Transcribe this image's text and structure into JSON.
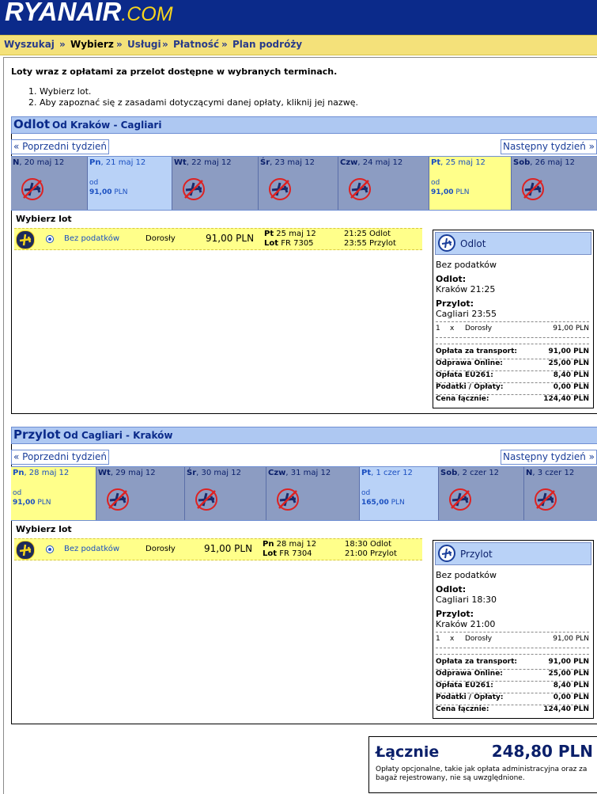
{
  "logo": {
    "brand": "RYANAIR",
    "suffix": ".COM"
  },
  "breadcrumb": [
    "Wyszukaj",
    "»",
    "Wybierz",
    "»",
    "Usługi",
    "»",
    "Płatność",
    "»",
    "Plan podróży"
  ],
  "intro": {
    "title": "Loty wraz z opłatami za przelot dostępne w wybranych terminach.",
    "items": [
      "1.  Wybierz lot.",
      "2.  Aby zapoznać się z zasadami dotyczącymi danej opłaty, kliknij jej nazwę."
    ]
  },
  "prev_week": "« Poprzedni tydzień",
  "next_week": "Następny tydzień »",
  "choose_flight": "Wybierz lot",
  "outbound": {
    "heading": "Odlot",
    "route": "Od Kraków - Cagliari",
    "days": [
      {
        "dow": "N",
        "date": ", 20 maj 12",
        "status": "none"
      },
      {
        "dow": "Pn",
        "date": ", 21 maj 12",
        "status": "available",
        "od": "od",
        "price": "91,00",
        "cur": "PLN"
      },
      {
        "dow": "Wt",
        "date": ", 22 maj 12",
        "status": "none"
      },
      {
        "dow": "Śr",
        "date": ", 23 maj 12",
        "status": "none"
      },
      {
        "dow": "Czw",
        "date": ", 24 maj 12",
        "status": "none"
      },
      {
        "dow": "Pt",
        "date": ", 25 maj 12",
        "status": "selected",
        "od": "od",
        "price": "91,00",
        "cur": "PLN"
      },
      {
        "dow": "Sob",
        "date": ", 26 maj 12",
        "status": "none"
      }
    ],
    "flight": {
      "fare": "Bez podatków",
      "pax": "Dorosły",
      "price": "91,00 PLN",
      "dow": "Pt",
      "date": "25 maj 12",
      "lot_label": "Lot",
      "flight_no": "FR 7305",
      "dep": "21:25 Odlot",
      "arr": "23:55 Przylot"
    },
    "summary": {
      "title": "Odlot",
      "fare": "Bez podatków",
      "dep_label": "Odlot:",
      "dep_value": "Kraków 21:25",
      "arr_label": "Przylot:",
      "arr_value": "Cagliari 23:55",
      "line": {
        "qty": "1",
        "x": "x",
        "pax": "Dorosły",
        "amount": "91,00 PLN"
      },
      "rows": [
        {
          "label": "Opłata za transport:",
          "value": "91,00 PLN"
        },
        {
          "label": "Odprawa Online:",
          "value": "25,00 PLN"
        },
        {
          "label": "Opłata EU261:",
          "value": "8,40 PLN"
        },
        {
          "label": "Podatki / Opłaty:",
          "value": "0,00 PLN"
        },
        {
          "label": "Cena łącznie:",
          "value": "124,40 PLN"
        }
      ]
    }
  },
  "inbound": {
    "heading": "Przylot",
    "route": "Od Cagliari - Kraków",
    "days": [
      {
        "dow": "Pn",
        "date": ", 28 maj 12",
        "status": "selected",
        "od": "od",
        "price": "91,00",
        "cur": "PLN"
      },
      {
        "dow": "Wt",
        "date": ", 29 maj 12",
        "status": "none"
      },
      {
        "dow": "Śr",
        "date": ", 30 maj 12",
        "status": "none"
      },
      {
        "dow": "Czw",
        "date": ", 31 maj 12",
        "status": "none"
      },
      {
        "dow": "Pt",
        "date": ", 1 czer 12",
        "status": "available",
        "od": "od",
        "price": "165,00",
        "cur": "PLN"
      },
      {
        "dow": "Sob",
        "date": ", 2 czer 12",
        "status": "none"
      },
      {
        "dow": "N",
        "date": ", 3 czer 12",
        "status": "none"
      }
    ],
    "flight": {
      "fare": "Bez podatków",
      "pax": "Dorosły",
      "price": "91,00 PLN",
      "dow": "Pn",
      "date": "28 maj 12",
      "lot_label": "Lot",
      "flight_no": "FR 7304",
      "dep": "18:30 Odlot",
      "arr": "21:00 Przylot"
    },
    "summary": {
      "title": "Przylot",
      "fare": "Bez podatków",
      "dep_label": "Odlot:",
      "dep_value": "Cagliari 18:30",
      "arr_label": "Przylot:",
      "arr_value": "Kraków 21:00",
      "line": {
        "qty": "1",
        "x": "x",
        "pax": "Dorosły",
        "amount": "91,00 PLN"
      },
      "rows": [
        {
          "label": "Opłata za transport:",
          "value": "91,00 PLN"
        },
        {
          "label": "Odprawa Online:",
          "value": "25,00 PLN"
        },
        {
          "label": "Opłata EU261:",
          "value": "8,40 PLN"
        },
        {
          "label": "Podatki / Opłaty:",
          "value": "0,00 PLN"
        },
        {
          "label": "Cena łącznie:",
          "value": "124,40 PLN"
        }
      ]
    }
  },
  "total": {
    "label": "Łącznie",
    "value": "248,80 PLN",
    "note": "Opłaty opcjonalne, takie jak opłata administracyjna oraz za bagaż rejestrowany, nie są uwzględnione."
  }
}
